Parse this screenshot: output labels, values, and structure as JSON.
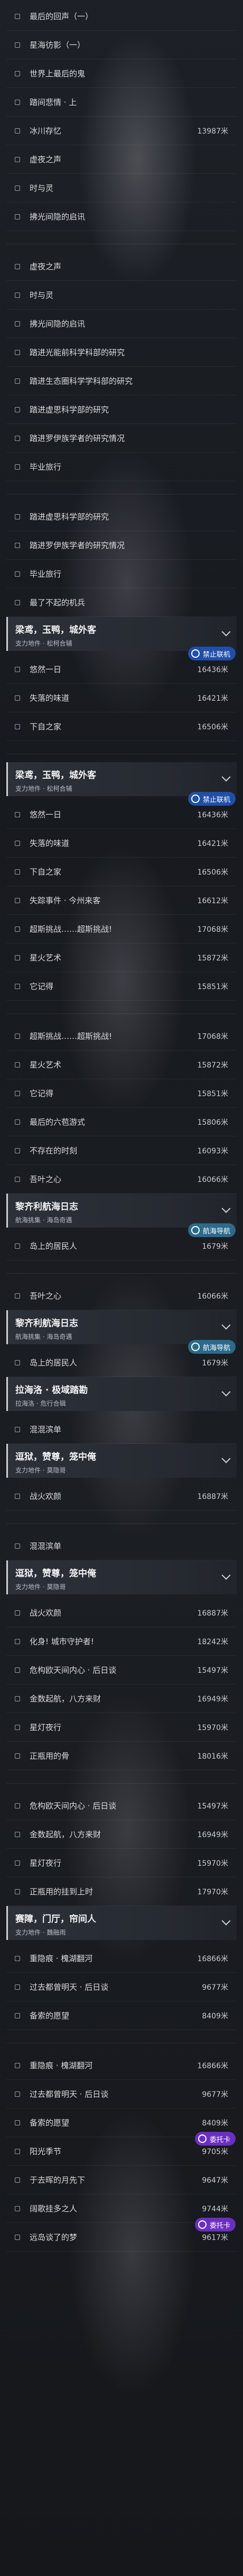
{
  "blocks": [
    {
      "type": "row",
      "label": "最后的回声（一）",
      "dist": ""
    },
    {
      "type": "row",
      "label": "星海彷影（一）",
      "dist": ""
    },
    {
      "type": "row",
      "label": "世界上最后的鬼",
      "dist": ""
    },
    {
      "type": "row",
      "label": "踏间悲情 · 上",
      "dist": ""
    },
    {
      "type": "row",
      "label": "冰川存忆",
      "dist": "13987米"
    },
    {
      "type": "row",
      "label": "虚夜之声",
      "dist": ""
    },
    {
      "type": "row",
      "label": "时与灵",
      "dist": ""
    },
    {
      "type": "row",
      "label": "拂光间隐的启讯",
      "dist": ""
    },
    {
      "type": "sep"
    },
    {
      "type": "row",
      "label": "虚夜之声",
      "dist": ""
    },
    {
      "type": "row",
      "label": "时与灵",
      "dist": ""
    },
    {
      "type": "row",
      "label": "拂光间隐的启讯",
      "dist": ""
    },
    {
      "type": "row",
      "label": "踏进光能前科学科部的研究",
      "dist": ""
    },
    {
      "type": "row",
      "label": "踏进生态圈科学学科部的研究",
      "dist": ""
    },
    {
      "type": "row",
      "label": "踏进虚思科学部的研究",
      "dist": ""
    },
    {
      "type": "row",
      "label": "踏进罗伊族学者的研究情况",
      "dist": ""
    },
    {
      "type": "row",
      "label": "毕业旅行",
      "dist": ""
    },
    {
      "type": "sep"
    },
    {
      "type": "row",
      "label": "踏进虚思科学部的研究",
      "dist": ""
    },
    {
      "type": "row",
      "label": "踏进罗伊族学者的研究情况",
      "dist": ""
    },
    {
      "type": "row",
      "label": "毕业旅行",
      "dist": ""
    },
    {
      "type": "row",
      "label": "最了不起的机兵",
      "dist": ""
    },
    {
      "type": "header",
      "title": "梁鸢，玉鸭，城外客",
      "sub": "支力地件 · 松柯合辅",
      "badge": "禁止联机",
      "badgeType": "ban"
    },
    {
      "type": "row",
      "label": "悠然一日",
      "dist": "16436米"
    },
    {
      "type": "row",
      "label": "失落的味道",
      "dist": "16421米"
    },
    {
      "type": "row",
      "label": "下自之家",
      "dist": "16506米"
    },
    {
      "type": "sep"
    },
    {
      "type": "header",
      "title": "梁鸢，玉鸭，城外客",
      "sub": "支力地件 · 松柯合辅",
      "badge": "禁止联机",
      "badgeType": "ban"
    },
    {
      "type": "row",
      "label": "悠然一日",
      "dist": "16436米"
    },
    {
      "type": "row",
      "label": "失落的味道",
      "dist": "16421米"
    },
    {
      "type": "row",
      "label": "下自之家",
      "dist": "16506米"
    },
    {
      "type": "row",
      "label": "失踪事件 · 今州来客",
      "dist": "16612米"
    },
    {
      "type": "row",
      "label": "超斯挑战……超斯挑战!",
      "dist": "17068米"
    },
    {
      "type": "row",
      "label": "星火艺术",
      "dist": "15872米"
    },
    {
      "type": "row",
      "label": "它记得",
      "dist": "15851米"
    },
    {
      "type": "sep"
    },
    {
      "type": "row",
      "label": "超斯挑战……超斯挑战!",
      "dist": "17068米"
    },
    {
      "type": "row",
      "label": "星火艺术",
      "dist": "15872米"
    },
    {
      "type": "row",
      "label": "它记得",
      "dist": "15851米"
    },
    {
      "type": "row",
      "label": "最后的六苞游式",
      "dist": "15806米"
    },
    {
      "type": "row",
      "label": "不存在的时刻",
      "dist": "16093米"
    },
    {
      "type": "row",
      "label": "吾叶之心",
      "dist": "16066米"
    },
    {
      "type": "header",
      "title": "黎齐利航海日志",
      "sub": "航海挑集 · 海岛奇遇",
      "badge": "航海导航",
      "badgeType": "nav"
    },
    {
      "type": "row",
      "label": "岛上的居民人",
      "dist": "1679米"
    },
    {
      "type": "sep"
    },
    {
      "type": "row",
      "label": "吾叶之心",
      "dist": "16066米"
    },
    {
      "type": "header",
      "title": "黎齐利航海日志",
      "sub": "航海挑集 · 海岛奇遇",
      "badge": "航海导航",
      "badgeType": "nav"
    },
    {
      "type": "row",
      "label": "岛上的居民人",
      "dist": "1679米"
    },
    {
      "type": "header",
      "title": "拉海洛 · 极域踏勘",
      "sub": "拉海洛 · 危行合辑",
      "badge": "",
      "badgeType": ""
    },
    {
      "type": "row",
      "label": "混混滨单",
      "dist": ""
    },
    {
      "type": "header",
      "title": "逗狱，赞尊，笼中俺",
      "sub": "支力地件 · 莫隐哥",
      "badge": "",
      "badgeType": ""
    },
    {
      "type": "row",
      "label": "战火欢颜",
      "dist": "16887米"
    },
    {
      "type": "sep"
    },
    {
      "type": "row",
      "label": "混混滨单",
      "dist": ""
    },
    {
      "type": "header",
      "title": "逗狱，赞尊，笼中俺",
      "sub": "支力地件 · 莫隐哥",
      "badge": "",
      "badgeType": ""
    },
    {
      "type": "row",
      "label": "战火欢颜",
      "dist": "16887米"
    },
    {
      "type": "row",
      "label": "化身! 城市守护者!",
      "dist": "18242米"
    },
    {
      "type": "row",
      "label": "危构欧天间内心 · 后日谈",
      "dist": "15497米"
    },
    {
      "type": "row",
      "label": "金数起航，八方来财",
      "dist": "16949米"
    },
    {
      "type": "row",
      "label": "星灯夜行",
      "dist": "15970米"
    },
    {
      "type": "row",
      "label": "正瓶用的骨",
      "dist": "18016米"
    },
    {
      "type": "sep"
    },
    {
      "type": "row",
      "label": "危构欧天间内心 · 后日谈",
      "dist": "15497米"
    },
    {
      "type": "row",
      "label": "金数起航，八方来财",
      "dist": "16949米"
    },
    {
      "type": "row",
      "label": "星灯夜行",
      "dist": "15970米"
    },
    {
      "type": "row",
      "label": "正瓶用的挂到上时",
      "dist": "17970米"
    },
    {
      "type": "header",
      "title": "赛障，门厅，帘间人",
      "sub": "支力地件 · 魏融雨",
      "badge": "",
      "badgeType": ""
    },
    {
      "type": "row",
      "label": "重隐痕 · 槐湖翻河",
      "dist": "16866米"
    },
    {
      "type": "row",
      "label": "过去都曾明天 · 后日谈",
      "dist": "9677米"
    },
    {
      "type": "row",
      "label": "备索的愿望",
      "dist": "8409米"
    },
    {
      "type": "sep"
    },
    {
      "type": "row",
      "label": "重隐痕 · 槐湖翻河",
      "dist": "16866米"
    },
    {
      "type": "row",
      "label": "过去都曾明天 · 后日谈",
      "dist": "9677米"
    },
    {
      "type": "row",
      "label": "备索的愿望",
      "dist": "8409米",
      "badge": "委托卡",
      "badgeType": "wm"
    },
    {
      "type": "row",
      "label": "阳光季节",
      "dist": "9705米"
    },
    {
      "type": "row",
      "label": "于去晖的月先下",
      "dist": "9647米"
    },
    {
      "type": "row",
      "label": "阔歌挂多之人",
      "dist": "9744米",
      "badge": "委托卡",
      "badgeType": "wm"
    },
    {
      "type": "row",
      "label": "远岛谈了的梦",
      "dist": "9617米"
    }
  ]
}
